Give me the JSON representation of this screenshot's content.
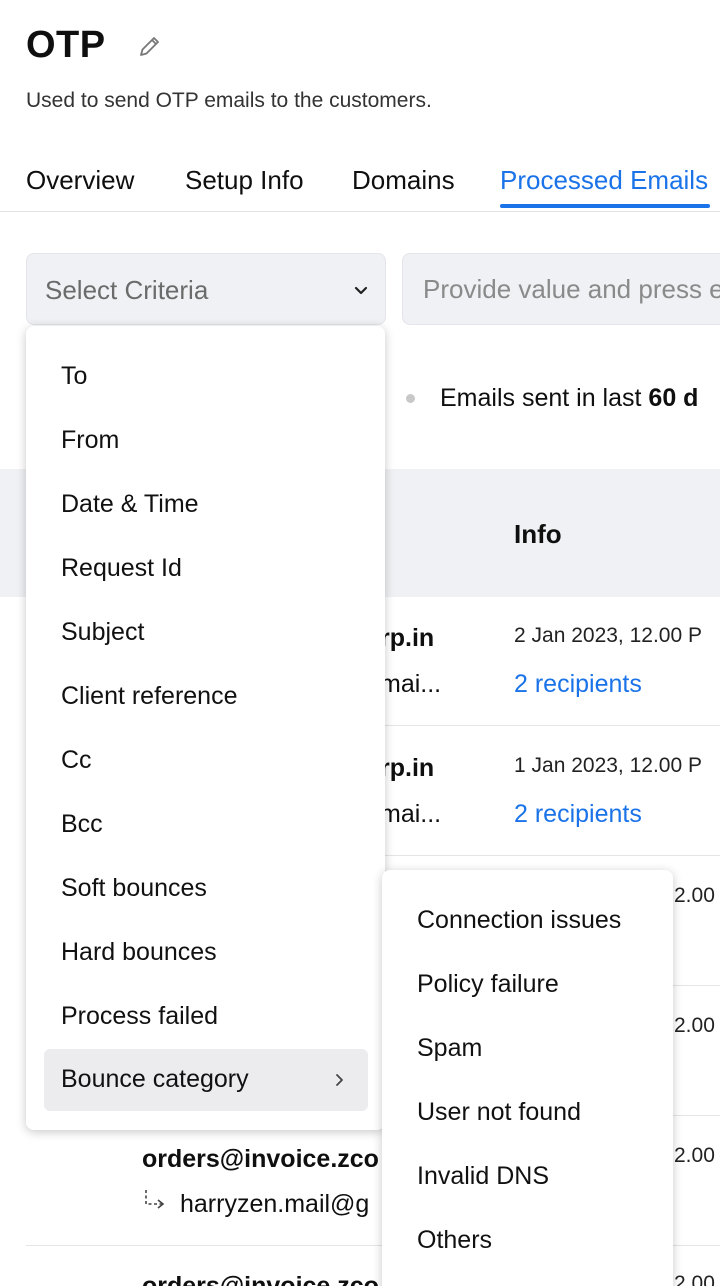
{
  "header": {
    "title": "OTP",
    "subtitle": "Used to send OTP emails to the customers."
  },
  "tabs": [
    {
      "label": "Overview",
      "active": false
    },
    {
      "label": "Setup Info",
      "active": false
    },
    {
      "label": "Domains",
      "active": false
    },
    {
      "label": "Processed Emails",
      "active": true
    }
  ],
  "filters": {
    "criteria_placeholder": "Select Criteria",
    "value_placeholder": "Provide value and press enter"
  },
  "info_line": {
    "prefix": "Emails sent in last",
    "days": "60 d"
  },
  "table": {
    "info_header": "Info",
    "rows": [
      {
        "sender": "rp.in",
        "recipient": "mai...",
        "date": "2 Jan 2023, 12.00 P",
        "recipients": "2 recipients"
      },
      {
        "sender": "rp.in",
        "recipient": "mai...",
        "date": "1 Jan 2023, 12.00 P",
        "recipients": "2 recipients"
      },
      {
        "date_partial": "2.00"
      },
      {
        "date_partial": "2.00"
      },
      {
        "sender": "orders@invoice.zco",
        "recipient": "harryzen.mail@g",
        "date_partial": "2.00"
      },
      {
        "sender": "orders@invoice.zco",
        "date_partial": "2.00"
      }
    ]
  },
  "criteria_menu": {
    "items": [
      "To",
      "From",
      "Date & Time",
      "Request Id",
      "Subject",
      "Client reference",
      "Cc",
      "Bcc",
      "Soft bounces",
      "Hard bounces",
      "Process failed",
      "Bounce category"
    ],
    "active_item": "Bounce category"
  },
  "bounce_submenu": {
    "items": [
      "Connection issues",
      "Policy failure",
      "Spam",
      "User not found",
      "Invalid DNS",
      "Others"
    ]
  },
  "colors": {
    "accent": "#1a73e8",
    "field_bg": "#f0f1f4",
    "active_item_bg": "#ececef"
  },
  "icons": {
    "edit": "pencil-icon",
    "select": "chevron-down-icon",
    "submenu": "chevron-right-icon",
    "reply": "reply-arrow-icon"
  }
}
